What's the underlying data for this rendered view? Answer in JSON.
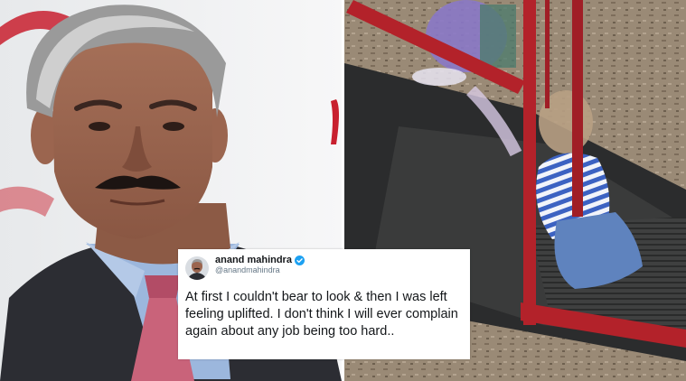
{
  "tweet": {
    "display_name": "anand mahindra",
    "handle": "@anandmahindra",
    "text": "At first I couldn't bear to look & then I was left feeling uplifted. I don't think I will ever complain again about any job being too hard.."
  },
  "icons": {
    "verified": "verified-badge-icon",
    "avatar": "profile-avatar"
  },
  "colors": {
    "verified_blue": "#1da1f2",
    "slide_red": "#b3222a",
    "handle_gray": "#657786",
    "text_dark": "#14171a"
  }
}
